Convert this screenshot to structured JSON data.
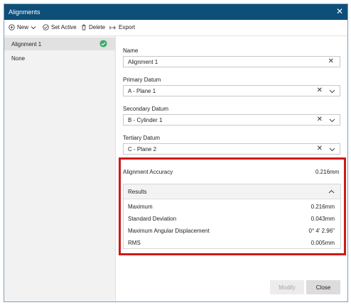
{
  "window": {
    "title": "Alignments"
  },
  "toolbar": {
    "new_label": "New",
    "set_active_label": "Set Active",
    "delete_label": "Delete",
    "export_label": "Export"
  },
  "sidebar": {
    "items": [
      {
        "label": "Alignment 1",
        "active": true
      },
      {
        "label": "None"
      }
    ]
  },
  "form": {
    "name_label": "Name",
    "name_value": "Alignment 1",
    "primary_label": "Primary Datum",
    "primary_value": "A - Plane 1",
    "secondary_label": "Secondary Datum",
    "secondary_value": "B - Cylinder 1",
    "tertiary_label": "Tertiary Datum",
    "tertiary_value": "C - Plane 2"
  },
  "accuracy": {
    "label": "Alignment Accuracy",
    "value": "0.216mm"
  },
  "results": {
    "title": "Results",
    "rows": [
      {
        "key": "Maximum",
        "value": "0.216mm"
      },
      {
        "key": "Standard Deviation",
        "value": "0.043mm"
      },
      {
        "key": "Maximum Angular Displacement",
        "value": "0° 4' 2.96\""
      },
      {
        "key": "RMS",
        "value": "0.005mm"
      }
    ]
  },
  "footer": {
    "modify_label": "Modify",
    "close_label": "Close"
  },
  "colors": {
    "titlebar": "#0d4f79",
    "active_check": "#3aaa6c",
    "highlight_border": "#cc1a1a"
  }
}
